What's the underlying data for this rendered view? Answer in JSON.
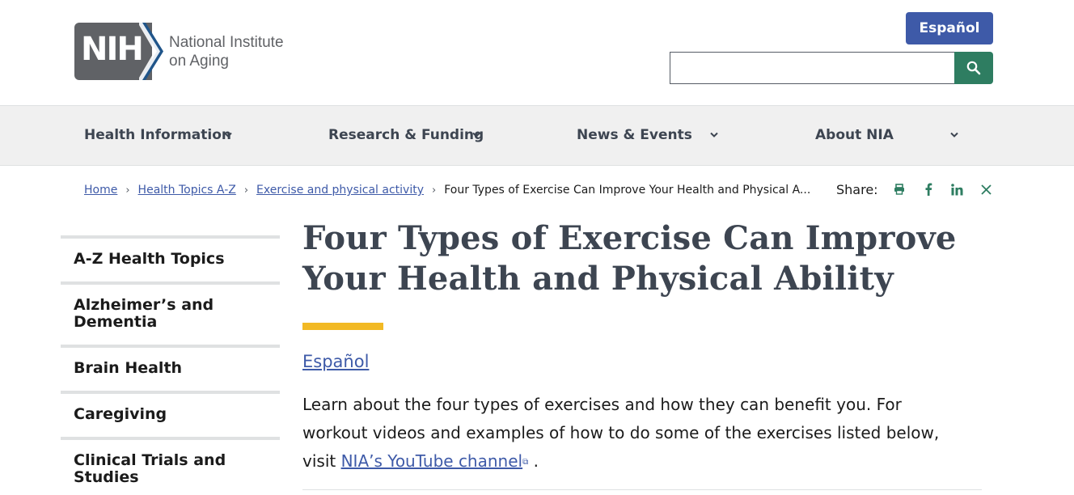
{
  "header": {
    "logo_mark": "NIH",
    "logo_line1": "National Institute",
    "logo_line2": "on Aging",
    "espanol_button": "Español",
    "search_placeholder": ""
  },
  "nav": {
    "items": [
      {
        "label": "Health Information"
      },
      {
        "label": "Research & Funding"
      },
      {
        "label": "News & Events"
      },
      {
        "label": "About NIA"
      }
    ]
  },
  "breadcrumb": {
    "items": [
      "Home",
      "Health Topics A-Z",
      "Exercise and physical activity"
    ],
    "current": "Four Types of Exercise Can Improve Your Health and Physical A..."
  },
  "share": {
    "label": "Share:",
    "icons": [
      "print-icon",
      "facebook-icon",
      "linkedin-icon",
      "x-icon"
    ]
  },
  "sidebar": {
    "items": [
      "A-Z Health Topics",
      "Alzheimer’s and Dementia",
      "Brain Health",
      "Caregiving",
      "Clinical Trials and Studies"
    ]
  },
  "main": {
    "title": "Four Types of Exercise Can Improve Your Health and Physical Ability",
    "language_link": "Español",
    "intro_text": "Learn about the four types of exercises and how they can benefit you. For workout videos and examples of how to do some of the exercises listed below, visit ",
    "intro_link": "NIA’s YouTube channel",
    "intro_end": " ."
  },
  "colors": {
    "brand_blue": "#3e5aa8",
    "search_green": "#2e7d61",
    "accent_gold": "#f2b924",
    "nav_bg": "#f0f0f0"
  }
}
